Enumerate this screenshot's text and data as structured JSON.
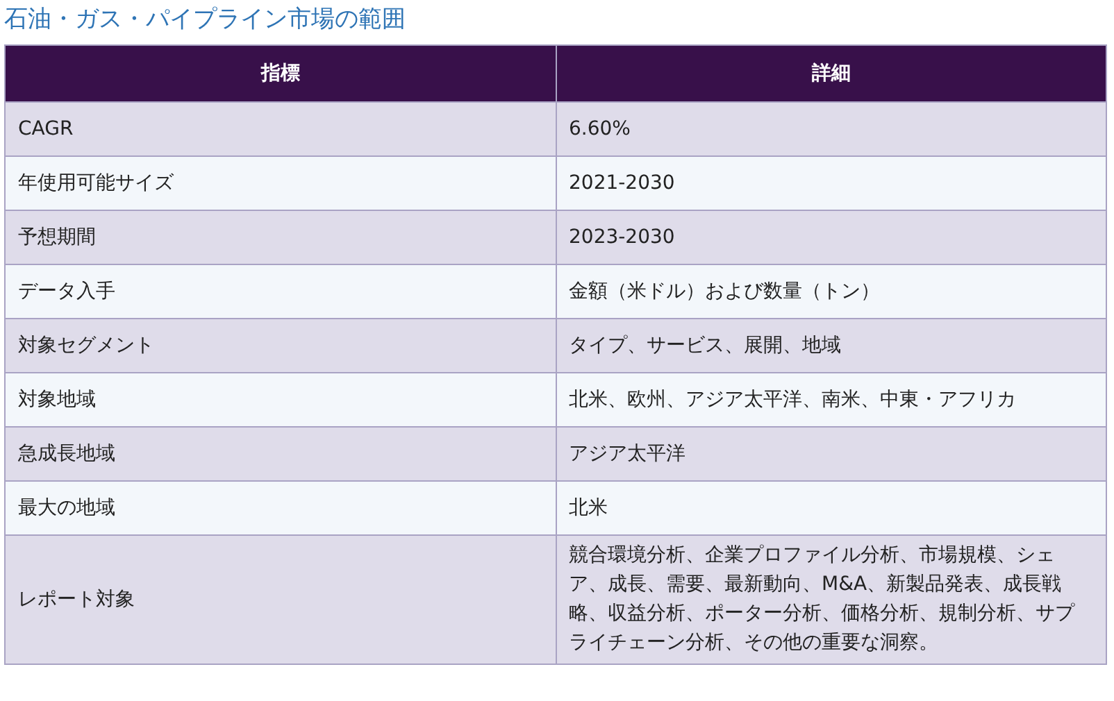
{
  "title": "石油・ガス・パイプライン市場の範囲",
  "table": {
    "columns": [
      "指標",
      "詳細"
    ],
    "rows": [
      {
        "metric": "CAGR",
        "detail": "6.60%"
      },
      {
        "metric": "年使用可能サイズ",
        "detail": "2021-2030"
      },
      {
        "metric": "予想期間",
        "detail": "2023-2030"
      },
      {
        "metric": "データ入手",
        "detail": "金額（米ドル）および数量（トン）"
      },
      {
        "metric": "対象セグメント",
        "detail": "タイプ、サービス、展開、地域"
      },
      {
        "metric": "対象地域",
        "detail": "北米、欧州、アジア太平洋、南米、中東・アフリカ"
      },
      {
        "metric": "急成長地域",
        "detail": "アジア太平洋"
      },
      {
        "metric": "最大の地域",
        "detail": "北米"
      },
      {
        "metric": "レポート対象",
        "detail": "競合環境分析、企業プロファイル分析、市場規模、シェア、成長、需要、最新動向、M&A、新製品発表、成長戦略、収益分析、ポーター分析、価格分析、規制分析、サプライチェーン分析、その他の重要な洞察。"
      }
    ]
  }
}
